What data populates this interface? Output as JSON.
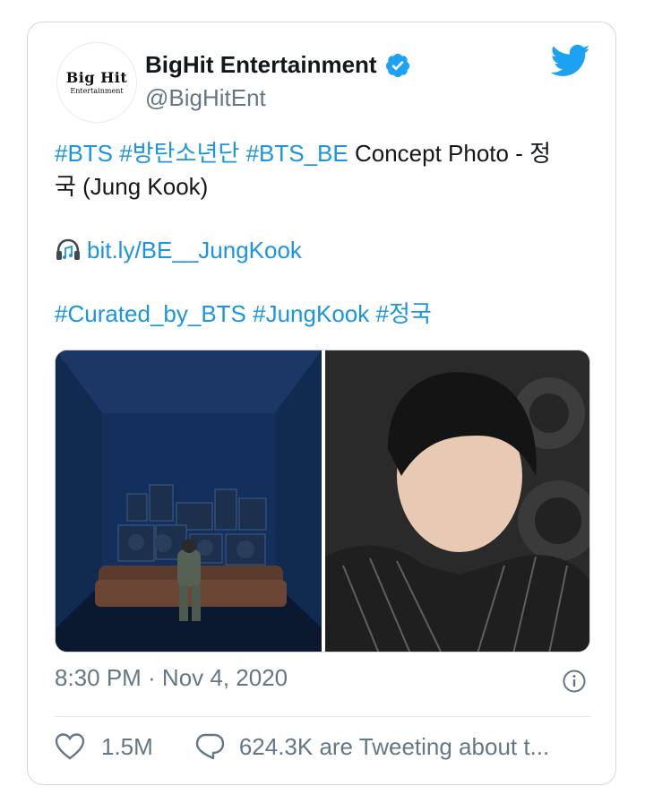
{
  "author": {
    "display_name": "BigHit Entertainment",
    "handle": "@BigHitEnt",
    "avatar_text": "Big Hit",
    "avatar_subtext": "Entertainment",
    "verified": true
  },
  "tweet": {
    "line1": {
      "tag1": "#BTS",
      "tag2": "#방탄소년단",
      "tag3": "#BTS_BE",
      "text": " Concept Photo - 정"
    },
    "line2": "국 (Jung Kook)",
    "link_icon": "headphone-icon",
    "link": "bit.ly/BE__JungKook",
    "tags": {
      "tag1": "#Curated_by_BTS",
      "tag2": "#JungKook",
      "tag3": "#정국"
    }
  },
  "timestamp": "8:30 PM · Nov 4, 2020",
  "actions": {
    "likes": "1.5M",
    "tweeting": "624.3K are Tweeting about t..."
  },
  "colors": {
    "accent": "#1b95e0",
    "muted": "#657786",
    "border": "#cfd9de"
  }
}
